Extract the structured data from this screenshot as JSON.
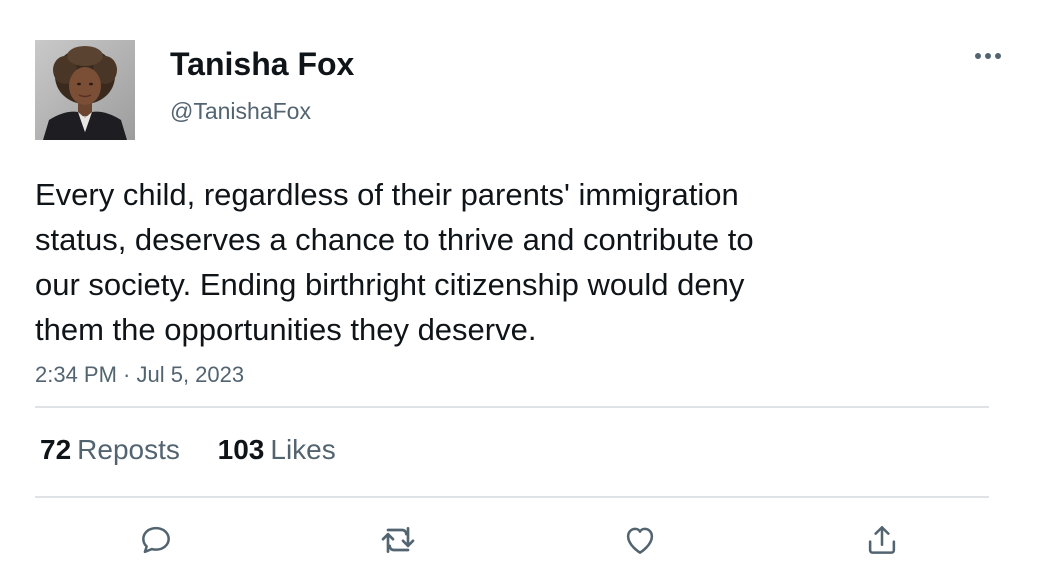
{
  "author": {
    "display_name": "Tanisha Fox",
    "handle": "@TanishaFox",
    "avatar_icon": "profile-photo"
  },
  "tweet": {
    "text_lines": [
      "Every child, regardless of their parents' immigration",
      "status, deserves a chance to thrive and contribute to",
      "our society. Ending birthright citizenship would deny",
      "them the opportunities they deserve."
    ],
    "timestamp": "2:34 PM · Jul 5, 2023"
  },
  "stats": {
    "reposts_count": "72",
    "reposts_label": "Reposts",
    "likes_count": "103",
    "likes_label": "Likes"
  },
  "actions": {
    "more_icon": "more-horizontal-icon",
    "reply_icon": "reply-icon",
    "repost_icon": "repost-icon",
    "like_icon": "heart-icon",
    "share_icon": "share-icon"
  },
  "colors": {
    "text_primary": "#0f1419",
    "text_secondary": "#536471",
    "divider": "#dfe3e6",
    "icon": "#536471"
  }
}
